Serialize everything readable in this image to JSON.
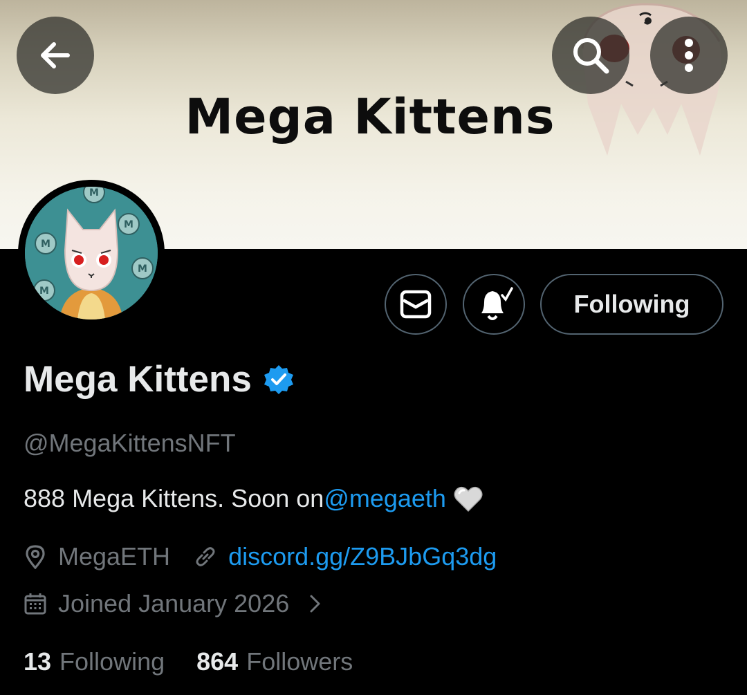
{
  "banner": {
    "title": "Mega Kittens"
  },
  "topbar": {
    "back_icon": "arrow-left-icon",
    "search_icon": "search-icon",
    "more_icon": "more-vertical-icon"
  },
  "actions": {
    "message_icon": "envelope-icon",
    "notify_icon": "bell-check-icon",
    "follow_label": "Following"
  },
  "profile": {
    "display_name": "Mega Kittens",
    "verified": true,
    "handle": "@MegaKittensNFT",
    "bio_text": "888 Mega Kittens. Soon on ",
    "bio_mention": "@megaeth",
    "bio_emoji": "white-heart-emoji",
    "location": "MegaETH",
    "website": "discord.gg/Z9BJbGq3dg",
    "joined": "Joined January 2026",
    "following_count": "13",
    "following_label": "Following",
    "followers_count": "864",
    "followers_label": "Followers"
  },
  "colors": {
    "background": "#000000",
    "text_primary": "#e7e9ea",
    "text_secondary": "#71767b",
    "link": "#1d9bf0",
    "button_border": "#536471"
  }
}
